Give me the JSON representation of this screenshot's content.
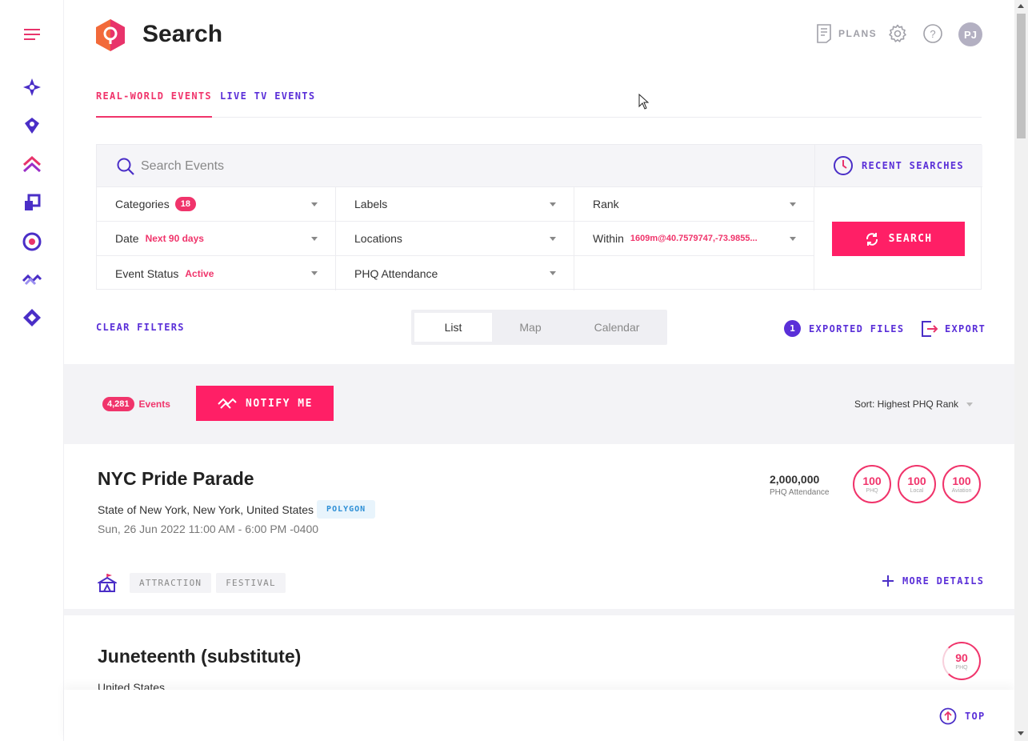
{
  "header": {
    "title": "Search",
    "plans_label": "PLANS",
    "avatar_initials": "PJ"
  },
  "tabs": [
    {
      "label": "REAL-WORLD EVENTS",
      "active": true
    },
    {
      "label": "LIVE TV EVENTS",
      "active": false
    }
  ],
  "search": {
    "placeholder": "Search Events",
    "recent_label": "RECENT SEARCHES",
    "button_label": "SEARCH"
  },
  "filters": {
    "categories": {
      "label": "Categories",
      "badge": "18"
    },
    "labels": {
      "label": "Labels"
    },
    "rank": {
      "label": "Rank"
    },
    "date": {
      "label": "Date",
      "value": "Next 90 days"
    },
    "locations": {
      "label": "Locations"
    },
    "within": {
      "label": "Within",
      "value": "1609m@40.7579747,-73.9855..."
    },
    "event_status": {
      "label": "Event Status",
      "value": "Active"
    },
    "phq_attendance": {
      "label": "PHQ Attendance"
    }
  },
  "view": {
    "clear_filters": "CLEAR FILTERS",
    "options": [
      "List",
      "Map",
      "Calendar"
    ],
    "selected": "List",
    "exported_count": "1",
    "exported_label": "EXPORTED FILES",
    "export_label": "EXPORT"
  },
  "results": {
    "count": "4,281",
    "count_label": "Events",
    "notify_label": "NOTIFY ME",
    "sort_label": "Sort: Highest PHQ Rank"
  },
  "events": [
    {
      "title": "NYC Pride Parade",
      "location": "State of New York, New York, United States",
      "geo_badge": "POLYGON",
      "date": "Sun, 26 Jun 2022 11:00 AM - 6:00 PM -0400",
      "attendance": "2,000,000",
      "attendance_label": "PHQ Attendance",
      "ranks": [
        {
          "value": "100",
          "label": "PHQ"
        },
        {
          "value": "100",
          "label": "Local"
        },
        {
          "value": "100",
          "label": "Aviation"
        }
      ],
      "tags": [
        "ATTRACTION",
        "FESTIVAL"
      ],
      "more_details": "MORE DETAILS"
    },
    {
      "title": "Juneteenth (substitute)",
      "location": "United States",
      "ranks": [
        {
          "value": "90",
          "label": "PHQ"
        }
      ]
    }
  ],
  "footer": {
    "top_label": "TOP"
  },
  "colors": {
    "accent_pink": "#f0346b",
    "accent_purple": "#5a2fd8",
    "button_pink": "#ff1f66"
  }
}
